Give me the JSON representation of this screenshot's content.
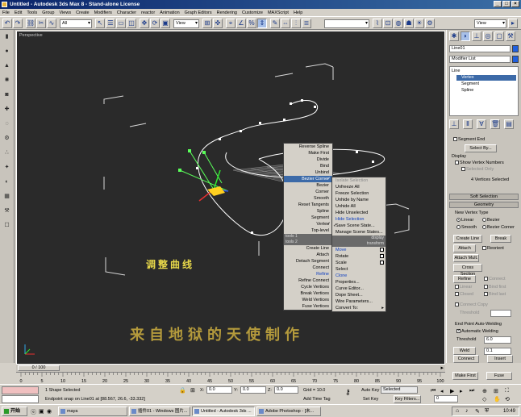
{
  "window": {
    "title": "Untitled - Autodesk 3ds Max 8 - Stand-alone License",
    "minimize": "_",
    "maximize": "□",
    "close": "×"
  },
  "menu": [
    "File",
    "Edit",
    "Tools",
    "Group",
    "Views",
    "Create",
    "Modifiers",
    "Character",
    "reactor",
    "Animation",
    "Graph Editors",
    "Rendering",
    "Customize",
    "MAXScript",
    "Help"
  ],
  "toolbar": {
    "selection_filter": "All",
    "ref_coord": "View",
    "named_selection": "",
    "right_view": "View"
  },
  "viewport": {
    "label": "Perspective",
    "caption_curve": "调整曲线",
    "caption_author": "来自地狱的天使制作"
  },
  "quad_left": {
    "items": [
      "Reverse Spline",
      "Make First",
      "Divide",
      "Bind",
      "Unbind",
      "Bezier Corner",
      "Bezier",
      "Corner",
      "Smooth",
      "Reset Tangents",
      "Spline",
      "Segment",
      "Vertex",
      "Top-level"
    ],
    "header": "tools 1",
    "header2": "tools 2",
    "items2": [
      "Create Line",
      "Attach",
      "Detach Segment",
      "Connect",
      "Refine",
      "Refine Connect",
      "Cycle Vertices",
      "Break Vertices",
      "Weld Vertices",
      "Fuse Vertices"
    ]
  },
  "quad_right": {
    "items": [
      "Isolate Selection",
      "Unfreeze All",
      "Freeze Selection",
      "Unhide by Name",
      "Unhide All",
      "Hide Unselected",
      "Hide Selection",
      "Save Scene State...",
      "Manage Scene States..."
    ],
    "header": "display",
    "header2": "transform",
    "items2": [
      "Move",
      "Rotate",
      "Scale",
      "Select",
      "Clone",
      "Properties...",
      "Curve Editor...",
      "Dope Sheet...",
      "Wire Parameters...",
      "Convert To:"
    ]
  },
  "panel": {
    "object_name": "Line01",
    "modifier_list": "Modifier List",
    "stack": [
      "Line",
      "Vertex",
      "Segment",
      "Spline"
    ],
    "selection": {
      "segment_end": "Segment End",
      "select_by": "Select By...",
      "display": "Display",
      "show_vertex_numbers": "Show Vertex Numbers",
      "selected_only": "Selected Only",
      "status": "4 Vertices Selected"
    },
    "soft_selection": "Soft Selection",
    "geometry": "Geometry",
    "new_vertex_type": "New Vertex Type",
    "vt_linear": "Linear",
    "vt_bezier": "Bezier",
    "vt_smooth": "Smooth",
    "vt_bezier_corner": "Bezier Corner",
    "create_line": "Create Line",
    "break": "Break",
    "attach": "Attach",
    "reorient": "Reorient",
    "attach_mult": "Attach Mult.",
    "cross_section": "Cross Section",
    "refine": "Refine",
    "connect": "Connect",
    "linear": "Linear",
    "bind_first": "Bind first",
    "closed": "Closed",
    "bind_last": "Bind last",
    "connect_copy": "Connect Copy",
    "threshold_label": "Threshold",
    "end_point_auto_welding": "End Point Auto-Welding",
    "automatic_welding": "Automatic Welding",
    "threshold": "Threshold",
    "threshold_val": "6.0",
    "weld": "Weld",
    "weld_val": "0.1",
    "connect2": "Connect",
    "insert": "Insert",
    "make_first": "Make First",
    "fuse": "Fuse"
  },
  "timeline": {
    "frame": "0 / 100",
    "ticks": [
      "0",
      "5",
      "10",
      "15",
      "20",
      "25",
      "30",
      "35",
      "40",
      "45",
      "50",
      "55",
      "60",
      "65",
      "70",
      "75",
      "80",
      "85",
      "90",
      "95",
      "100"
    ]
  },
  "status": {
    "selected": "1 Shape Selected",
    "prompt": "Endpoint snap on Line01 at [88.567, 26.6, -33.332]",
    "x_label": "X:",
    "x": "0.0",
    "y_label": "Y:",
    "y": "0.0",
    "z_label": "Z:",
    "z": "0.0",
    "grid": "Grid = 10.0",
    "add_time_tag": "Add Time Tag",
    "auto_key": "Auto Key",
    "set_key": "Set Key",
    "key_mode": "Selected",
    "key_filters": "Key Filters...",
    "frame_val": "0"
  },
  "taskbar": {
    "start": "开始",
    "tasks": [
      "maya",
      "插件01 - Windows 图片...",
      "Untitled - Autodesk 3ds ...",
      "Adobe Photoshop - [未..."
    ],
    "clock": "10:49"
  }
}
